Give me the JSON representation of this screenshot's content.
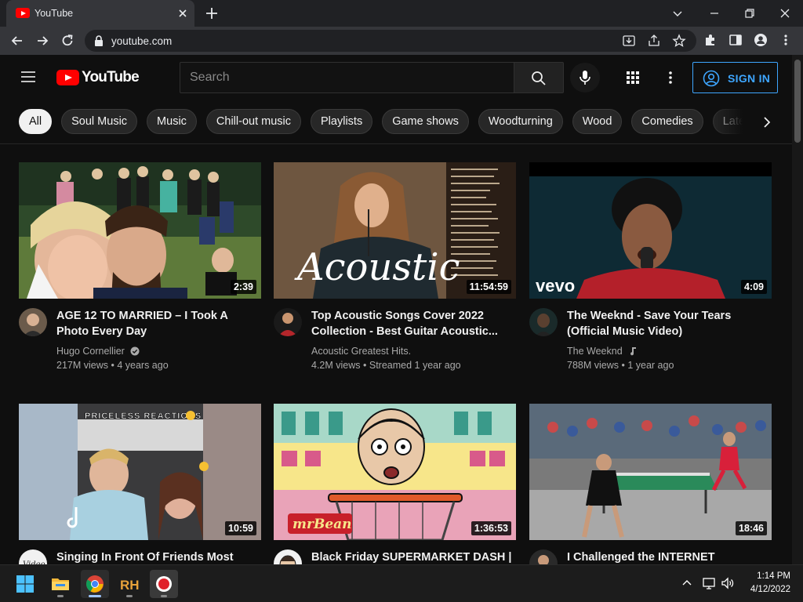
{
  "browser": {
    "tab_title": "YouTube",
    "url": "youtube.com"
  },
  "header": {
    "logo_text": "YouTube",
    "search_placeholder": "Search",
    "sign_in_label": "SIGN IN",
    "accent_color": "#3ea6ff",
    "brand_color": "#ff0000"
  },
  "chips": [
    "All",
    "Soul Music",
    "Music",
    "Chill-out music",
    "Playlists",
    "Game shows",
    "Woodturning",
    "Wood",
    "Comedies",
    "Late"
  ],
  "videos": [
    {
      "title": "AGE 12 TO MARRIED – I Took A Photo Every Day",
      "channel": "Hugo Cornellier",
      "channel_badge": "verified-icon",
      "views": "217M views",
      "age": "4 years ago",
      "duration": "2:39"
    },
    {
      "title": "Top Acoustic Songs Cover 2022 Collection - Best Guitar Acoustic...",
      "channel": "Acoustic Greatest Hits.",
      "channel_badge": "",
      "views": "4.2M views",
      "age": "Streamed 1 year ago",
      "duration": "11:54:59",
      "thumb_text": "Acoustic"
    },
    {
      "title": "The Weeknd - Save Your Tears (Official Music Video)",
      "channel": "The Weeknd",
      "channel_badge": "music-note-icon",
      "views": "788M views",
      "age": "1 year ago",
      "duration": "4:09",
      "thumb_text": "vevo"
    },
    {
      "title": "Singing In Front Of Friends Most",
      "channel": "",
      "views": "",
      "age": "",
      "duration": "10:59",
      "thumb_text": "PRICELESS REACTIONS"
    },
    {
      "title": "Black Friday SUPERMARKET DASH |",
      "channel": "",
      "views": "",
      "age": "",
      "duration": "1:36:53",
      "thumb_text": "mrBean"
    },
    {
      "title": "I Challenged the INTERNET",
      "channel": "",
      "views": "",
      "age": "",
      "duration": "18:46"
    }
  ],
  "taskbar": {
    "apps": [
      "windows-start-icon",
      "file-explorer-icon",
      "chrome-icon",
      "rh-app-icon",
      "record-icon"
    ],
    "time": "1:14 PM",
    "date": "4/12/2022"
  }
}
